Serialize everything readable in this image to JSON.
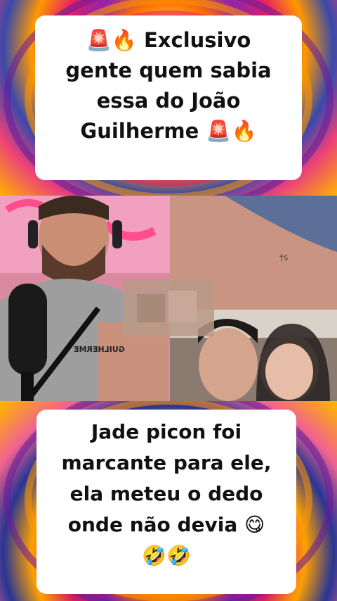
{
  "top_caption": {
    "lines": [
      "🚨🔥 Exclusivo",
      "gente quem sabia",
      "essa do João",
      "Guilherme 🚨🔥"
    ]
  },
  "video": {
    "shirt_text": "GUILHERME"
  },
  "bottom_caption": {
    "lines": [
      "Jade picon foi",
      "marcante para ele,",
      "ela meteu o dedo",
      "onde não devia 😋",
      "🤣🤣"
    ]
  },
  "colors": {
    "caption_bg": "#ffffff",
    "caption_text": "#111111",
    "swirl_pink": "#e91e63",
    "swirl_orange": "#ff9800",
    "swirl_purple": "#6a1b9a",
    "swirl_yellow": "#ffc107"
  }
}
